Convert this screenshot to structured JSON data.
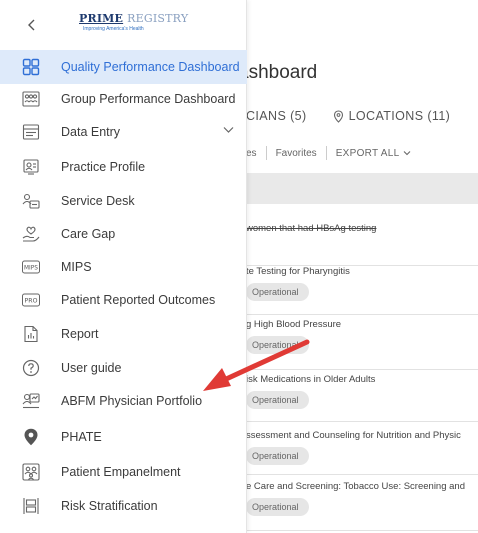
{
  "header": {
    "back_icon": "chevron-left-icon",
    "logo_line1a": "PRIME",
    "logo_line1b": "REGISTRY",
    "logo_tagline": "Improving America's Health"
  },
  "sidebar": {
    "items": [
      {
        "label": "Quality Performance Dashboard",
        "icon": "dashboard-grid-icon",
        "active": true
      },
      {
        "label": "Group Performance Dashboard",
        "icon": "group-dashboard-icon"
      },
      {
        "label": "Data Entry",
        "icon": "data-entry-icon",
        "expandable": true
      },
      {
        "label": "Practice Profile",
        "icon": "practice-profile-icon"
      },
      {
        "label": "Service Desk",
        "icon": "service-desk-icon"
      },
      {
        "label": "Care Gap",
        "icon": "care-gap-icon"
      },
      {
        "label": "MIPS",
        "icon": "mips-icon"
      },
      {
        "label": "Patient Reported Outcomes",
        "icon": "pro-icon"
      },
      {
        "label": "Report",
        "icon": "report-icon"
      },
      {
        "label": "User guide",
        "icon": "help-circle-icon"
      },
      {
        "label": "ABFM Physician Portfolio",
        "icon": "abfm-portfolio-icon"
      },
      {
        "label": "PHATE",
        "icon": "phate-pin-icon"
      },
      {
        "label": "Patient Empanelment",
        "icon": "empanelment-icon"
      },
      {
        "label": "Risk Stratification",
        "icon": "risk-stratification-icon"
      }
    ],
    "mips_badge": "MIPS",
    "pro_badge": "PRO"
  },
  "background": {
    "title": "ashboard",
    "tabs": {
      "physicians": "CIANS (5)",
      "locations": "LOCATIONS (11)"
    },
    "toolbar": {
      "item1": "es",
      "item2": "Favorites",
      "export": "EXPORT ALL"
    },
    "rows": [
      {
        "text": "women that had HBsAg testing"
      },
      {
        "text": "te Testing for Pharyngitis",
        "status": "Operational"
      },
      {
        "text": "g High Blood Pressure",
        "status": "Operational"
      },
      {
        "text": "isk Medications in Older Adults",
        "status": "Operational"
      },
      {
        "text": "ssessment and Counseling for Nutrition and Physic",
        "status": "Operational"
      },
      {
        "text": "e Care and Screening: Tobacco Use: Screening and",
        "status": "Operational"
      }
    ]
  },
  "colors": {
    "active_bg": "#deeafa",
    "active_text": "#2f6fd6",
    "logo_navy": "#1e3a6e",
    "arrow": "#e03a35"
  }
}
